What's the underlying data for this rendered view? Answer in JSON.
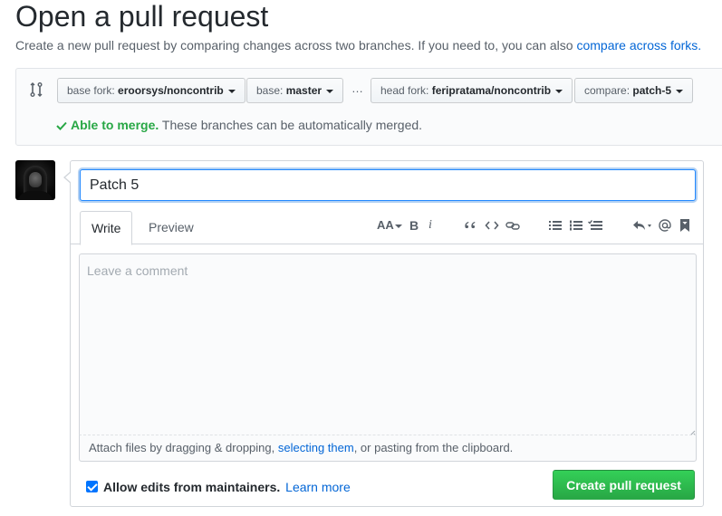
{
  "page": {
    "title": "Open a pull request",
    "subtitle_text": "Create a new pull request by comparing changes across two branches. If you need to, you can also",
    "subtitle_link": "compare across forks."
  },
  "range": {
    "base_fork": {
      "label": "base fork:",
      "value": "eroorsys/noncontrib"
    },
    "base": {
      "label": "base:",
      "value": "master"
    },
    "separator": "…",
    "head_fork": {
      "label": "head fork:",
      "value": "feripratama/noncontrib"
    },
    "compare": {
      "label": "compare:",
      "value": "patch-5"
    },
    "merge_status_strong": "Able to merge.",
    "merge_status_text": "These branches can be automatically merged."
  },
  "form": {
    "title_value": "Patch 5",
    "tabs": [
      {
        "label": "Write"
      },
      {
        "label": "Preview"
      }
    ],
    "toolbar": {
      "header": "AA",
      "bold": "B",
      "italic": "i"
    },
    "comment_placeholder": "Leave a comment",
    "attach_text_1": "Attach files by dragging & dropping,",
    "attach_link": "selecting them",
    "attach_text_2": ", or pasting from the clipboard.",
    "allow_edits_label": "Allow edits from maintainers.",
    "learn_more": "Learn more",
    "submit_label": "Create pull request"
  },
  "colors": {
    "accent": "#0366d6",
    "success": "#28a745",
    "button_green": "#2cbe4e"
  }
}
